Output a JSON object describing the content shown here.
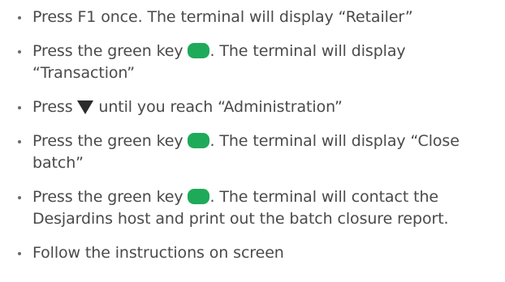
{
  "steps": [
    {
      "text": "Press F1 once. The terminal will display “Retailer”"
    },
    {
      "before": "Press the green key ",
      "icon": "green-key-icon",
      "after": ". The terminal will display “Transaction”"
    },
    {
      "before": "Press ",
      "icon": "down-arrow-icon",
      "after": " until you reach “Administration”"
    },
    {
      "before": "Press the green key ",
      "icon": "green-key-icon",
      "after": ". The terminal will display “Close batch”"
    },
    {
      "before": "Press the green key ",
      "icon": "green-key-icon",
      "after": ". The terminal will contact the Desjardins host and print out the batch closure report."
    },
    {
      "text": "Follow the instructions on screen"
    }
  ],
  "colors": {
    "green_key": "#1faa5a",
    "arrow": "#2b2b2b",
    "text": "#4a4a4a"
  }
}
